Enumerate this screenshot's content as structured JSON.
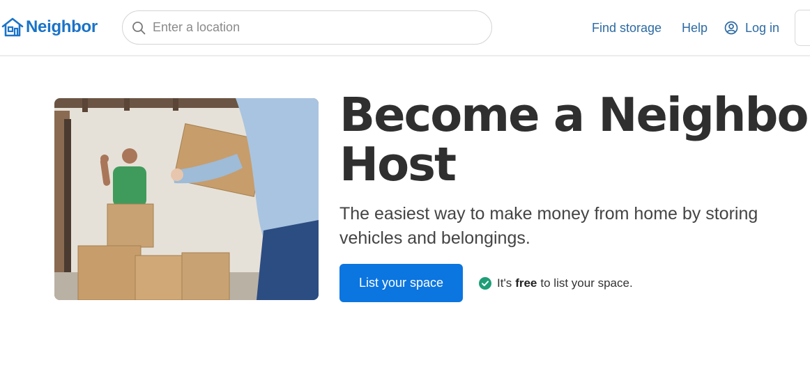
{
  "header": {
    "logo_text": "Neighbor",
    "logo_icon": "house-icon",
    "search": {
      "placeholder": "Enter a location",
      "value": "",
      "icon": "search-icon"
    },
    "nav": {
      "find_storage": "Find storage",
      "help": "Help",
      "login": "Log in",
      "login_icon": "user-circle-icon"
    }
  },
  "hero": {
    "image_alt": "Man waving behind moving boxes while another person carries a box",
    "title_line1": "Become a Neighbor",
    "title_line2": "Host",
    "subtitle": "The easiest way to make money from home by storing vehicles and belongings.",
    "cta_label": "List your space",
    "free_note": {
      "icon": "check-circle-icon",
      "prefix": "It's",
      "emphasis": "free",
      "suffix": "to list your space."
    }
  },
  "colors": {
    "brand_blue": "#1a73c8",
    "cta_blue": "#0b75e0",
    "link_blue": "#2c6aa3",
    "check_green": "#1f9e77",
    "heading": "#2f2f2f"
  }
}
